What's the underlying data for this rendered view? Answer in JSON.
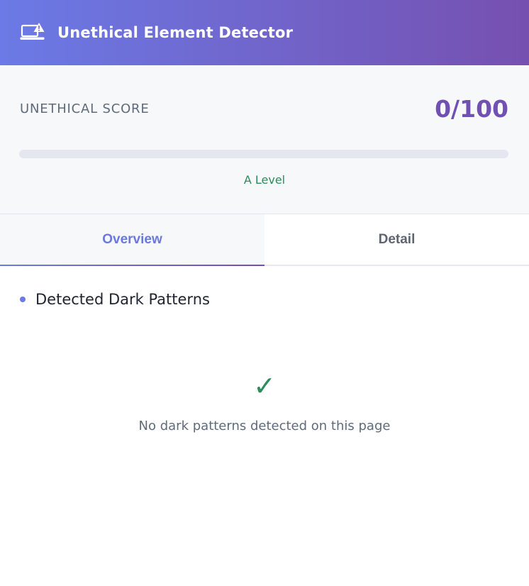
{
  "header": {
    "title": "Unethical Element Detector",
    "icon": "laptop-warning-icon"
  },
  "score": {
    "label": "UNETHICAL SCORE",
    "value": "0/100",
    "progress_percent": 0,
    "level": "A Level"
  },
  "tabs": [
    {
      "label": "Overview",
      "active": true
    },
    {
      "label": "Detail",
      "active": false
    }
  ],
  "content": {
    "section_title": "Detected Dark Patterns",
    "empty_icon": "check-icon",
    "empty_glyph": "✓",
    "empty_message": "No dark patterns detected on this page"
  },
  "colors": {
    "header_gradient_start": "#6b7ae6",
    "header_gradient_end": "#7650b0",
    "score_value": "#7050b2",
    "level_green": "#2e8b5a",
    "active_tab": "#6a79e0"
  }
}
